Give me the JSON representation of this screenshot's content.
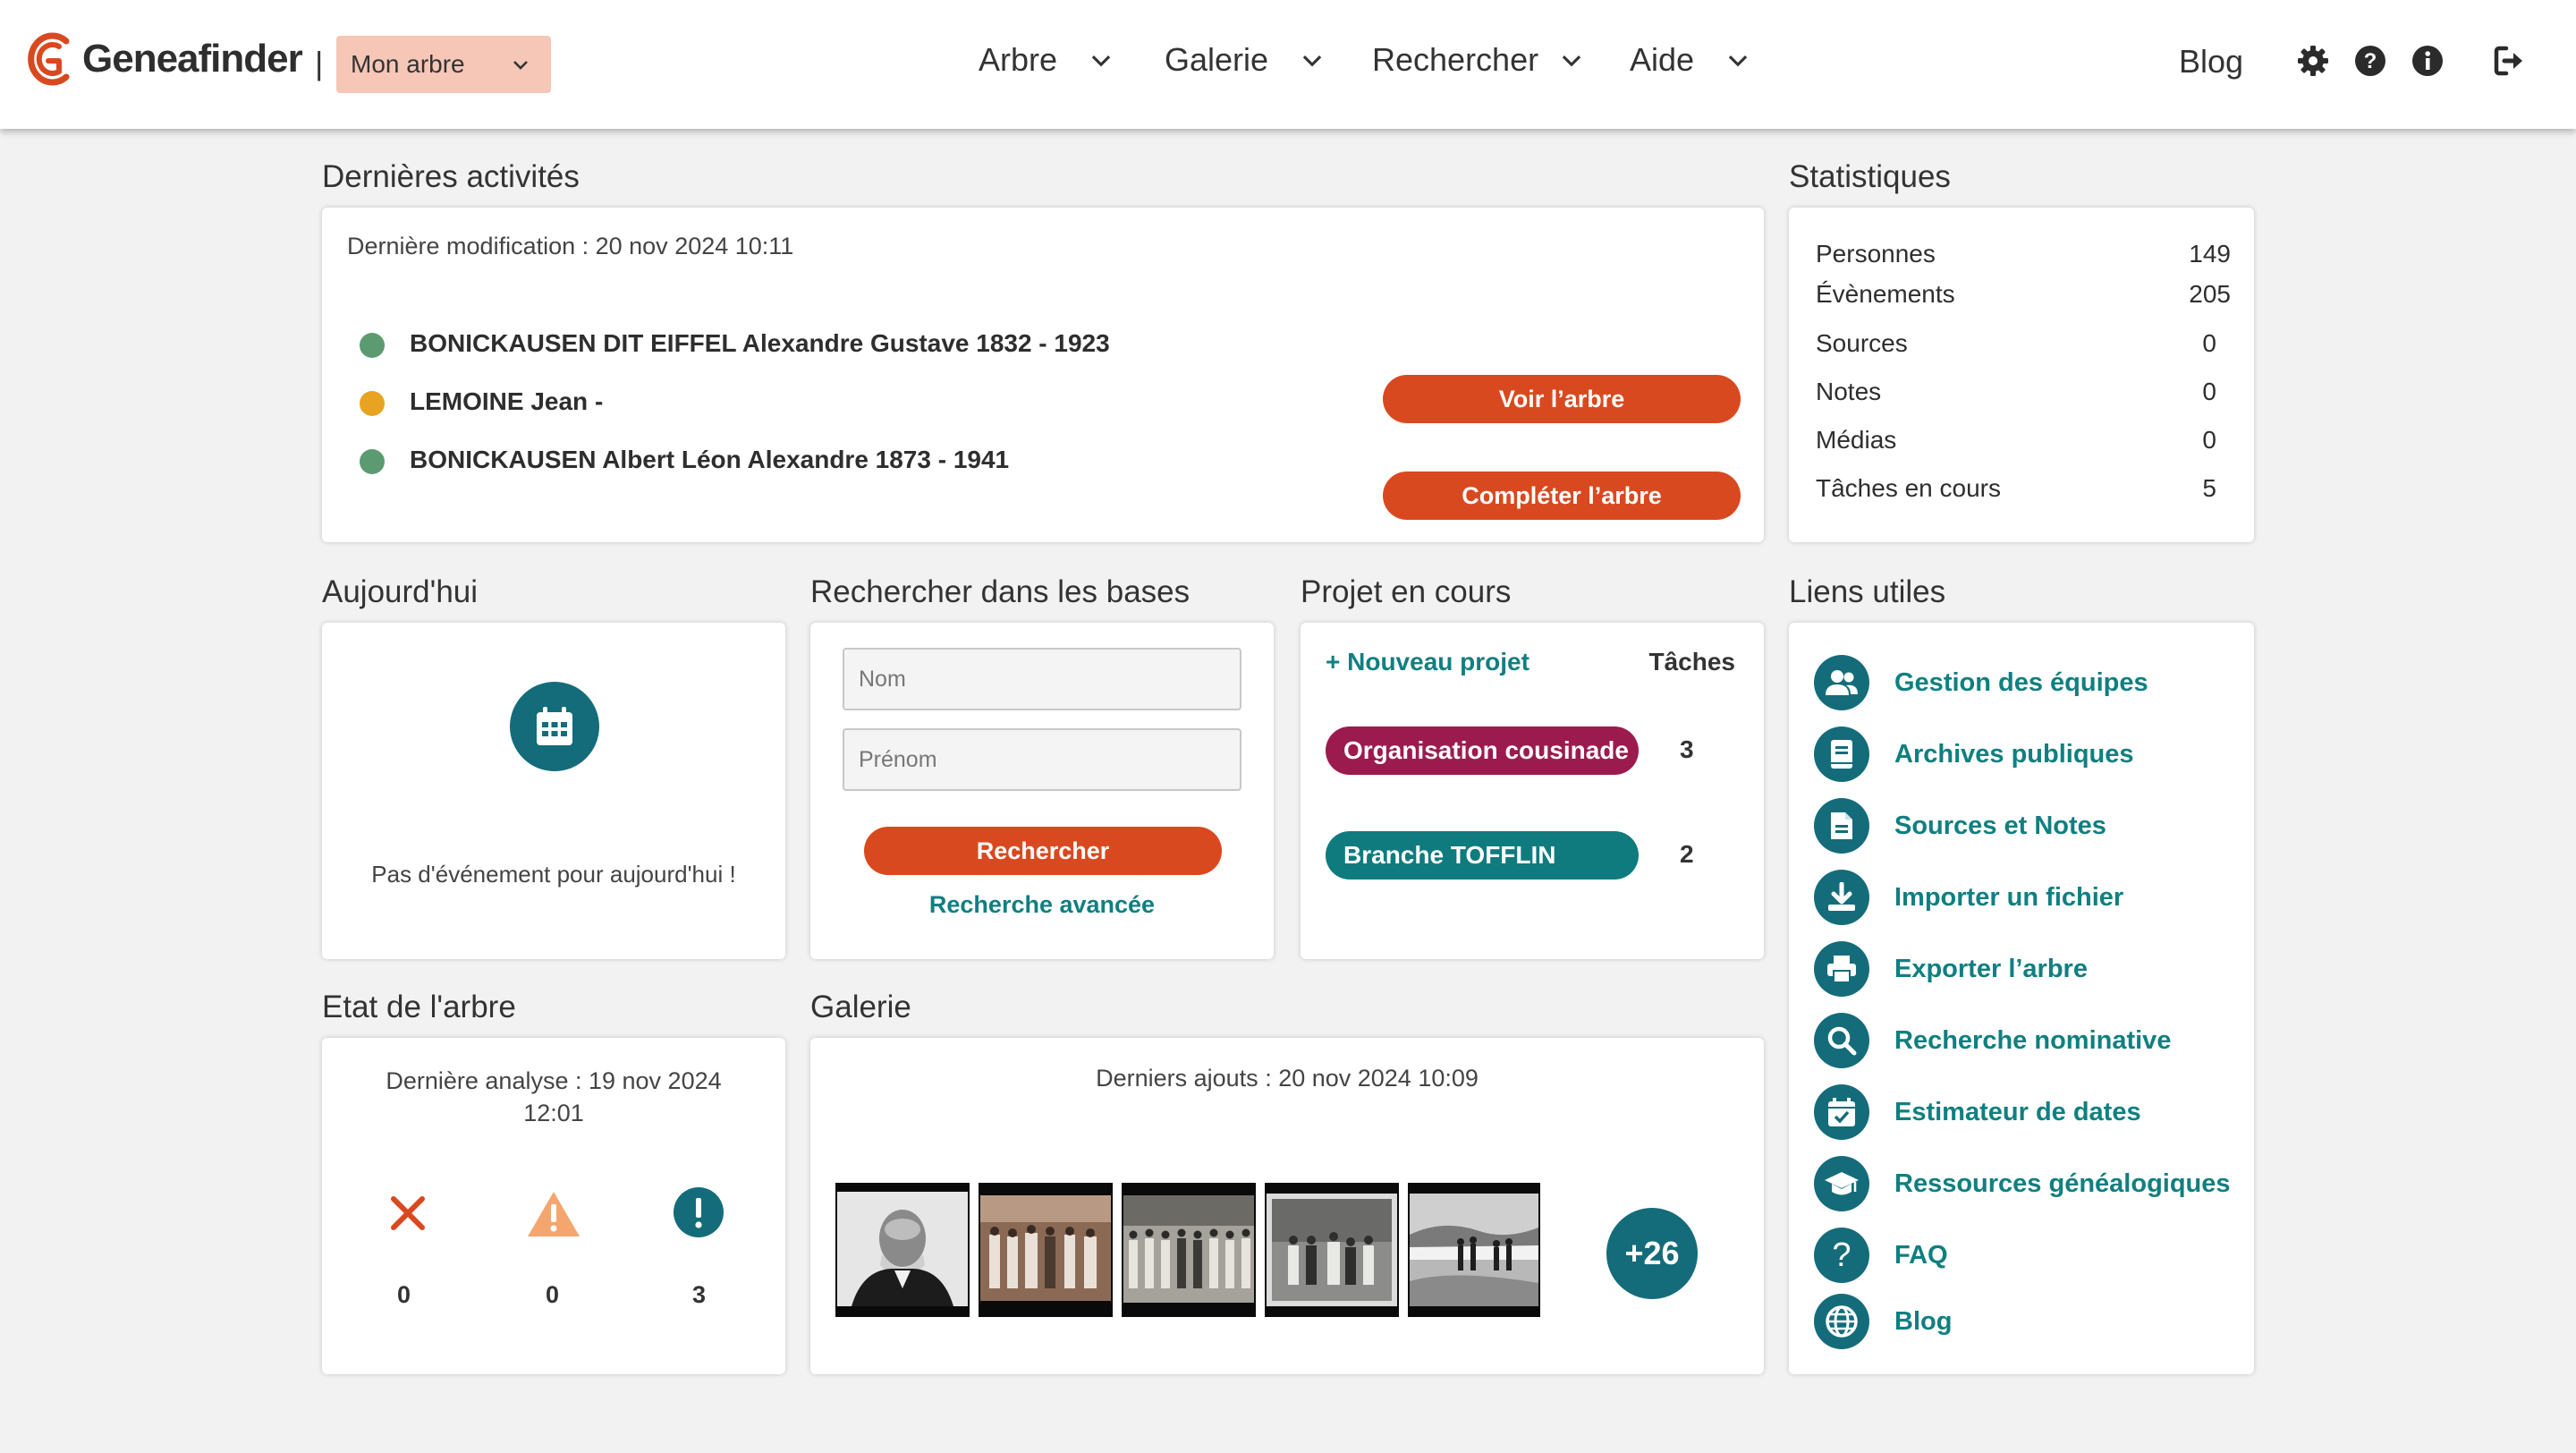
{
  "header": {
    "logo_text": "Geneafinder",
    "separator": "|",
    "tree_select": "Mon arbre",
    "nav": [
      "Arbre",
      "Galerie",
      "Rechercher",
      "Aide"
    ],
    "blog": "Blog",
    "icons": [
      "gear-icon",
      "help-icon",
      "info-icon",
      "logout-icon"
    ]
  },
  "activities": {
    "title": "Dernières activités",
    "last_modification": "Dernière modification : 20 nov 2024 10:11",
    "items": [
      {
        "name": "BONICKAUSEN DIT EIFFEL Alexandre Gustave 1832 - 1923",
        "status_color": "#5c9a72"
      },
      {
        "name": "LEMOINE Jean -",
        "status_color": "#e8a321"
      },
      {
        "name": "BONICKAUSEN Albert Léon Alexandre 1873 - 1941",
        "status_color": "#5c9a72"
      }
    ],
    "view_tree": "Voir l’arbre",
    "complete_tree": "Compléter l’arbre"
  },
  "stats": {
    "title": "Statistiques",
    "rows": [
      {
        "label": "Personnes",
        "value": "149"
      },
      {
        "label": "Évènements",
        "value": "205"
      },
      {
        "label": "Sources",
        "value": "0"
      },
      {
        "label": "Notes",
        "value": "0"
      },
      {
        "label": "Médias",
        "value": "0"
      },
      {
        "label": "Tâches en cours",
        "value": "5"
      }
    ]
  },
  "today": {
    "title": "Aujourd'hui",
    "empty": "Pas d'événement pour aujourd'hui !"
  },
  "search": {
    "title": "Rechercher dans les bases",
    "nom_placeholder": "Nom",
    "prenom_placeholder": "Prénom",
    "button": "Rechercher",
    "advanced": "Recherche avancée"
  },
  "projects": {
    "title": "Projet en cours",
    "new": "+ Nouveau projet",
    "tasks_header": "Tâches",
    "items": [
      {
        "name": "Organisation cousinade",
        "tasks": "3",
        "color": "#9b1b4e"
      },
      {
        "name": "Branche TOFFLIN",
        "tasks": "2",
        "color": "#0f7b7e"
      }
    ]
  },
  "links": {
    "title": "Liens utiles",
    "items": [
      {
        "label": "Gestion des équipes",
        "icon": "users-icon"
      },
      {
        "label": "Archives publiques",
        "icon": "book-icon"
      },
      {
        "label": "Sources et Notes",
        "icon": "document-icon"
      },
      {
        "label": "Importer un fichier",
        "icon": "download-icon"
      },
      {
        "label": "Exporter l’arbre",
        "icon": "printer-icon"
      },
      {
        "label": "Recherche nominative",
        "icon": "search-icon"
      },
      {
        "label": "Estimateur de dates",
        "icon": "calendar-check-icon"
      },
      {
        "label": "Ressources généalogiques",
        "icon": "graduation-cap-icon"
      },
      {
        "label": "FAQ",
        "icon": "question-icon"
      },
      {
        "label": "Blog",
        "icon": "globe-icon"
      }
    ]
  },
  "tree_state": {
    "title": "Etat de l'arbre",
    "last_analysis_line1": "Dernière analyse : 19 nov 2024",
    "last_analysis_line2": "12:01",
    "errors": "0",
    "warnings": "0",
    "infos": "3"
  },
  "gallery": {
    "title": "Galerie",
    "last_added": "Derniers ajouts : 20 nov 2024 10:09",
    "more": "+26"
  },
  "colors": {
    "accent_orange": "#d9491f",
    "teal": "#107f80",
    "select_bg": "#f6c6b6"
  }
}
